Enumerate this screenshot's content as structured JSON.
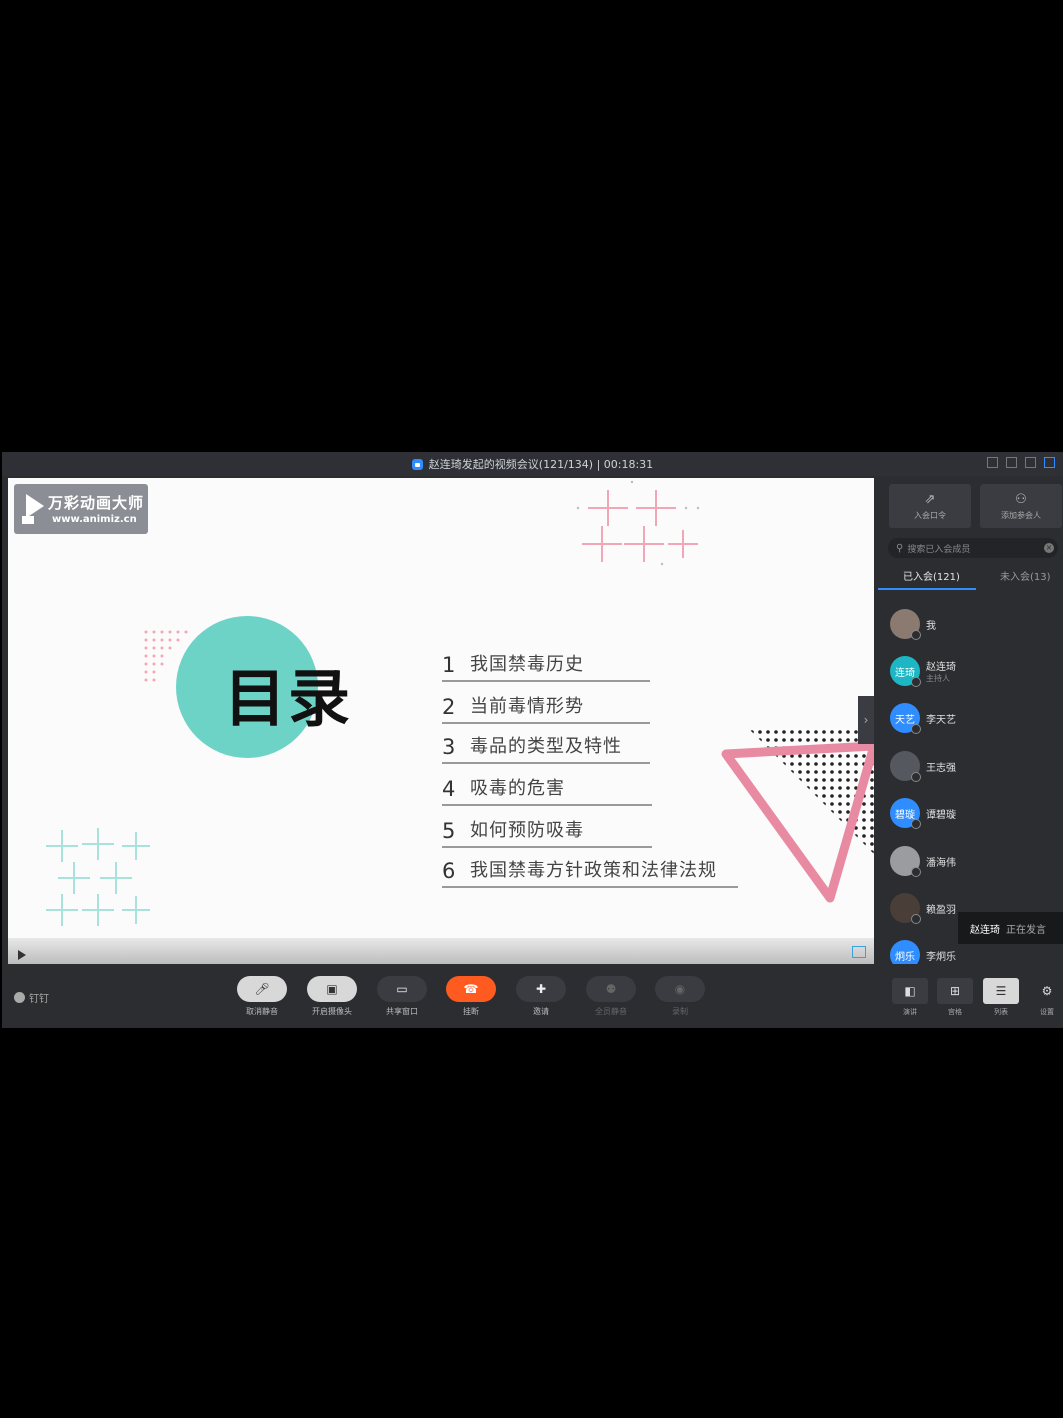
{
  "window": {
    "title": "赵连琦发起的视频会议(121/134) | 00:18:31"
  },
  "slide": {
    "logo": {
      "name": "万彩动画大师",
      "url": "www.animiz.cn"
    },
    "toc_title": "目录",
    "items": [
      {
        "num": "1",
        "label": "我国禁毒历史"
      },
      {
        "num": "2",
        "label": "当前毒情形势"
      },
      {
        "num": "3",
        "label": "毒品的类型及特性"
      },
      {
        "num": "4",
        "label": "吸毒的危害"
      },
      {
        "num": "5",
        "label": "如何预防吸毒"
      },
      {
        "num": "6",
        "label": "我国禁毒方针政策和法律法规"
      }
    ],
    "colors": {
      "circle": "#6dd3c7",
      "triangle": "#e98aa3",
      "accent_cross": "#f3a6b8",
      "teal_cross": "#a7e3dc"
    }
  },
  "panel": {
    "buttons": [
      {
        "icon": "share-icon",
        "label": "入会口令"
      },
      {
        "icon": "add-user-icon",
        "label": "添加参会人"
      }
    ],
    "search_placeholder": "搜索已入会成员",
    "tabs": [
      {
        "label": "已入会(121)",
        "active": true
      },
      {
        "label": "未入会(13)",
        "active": false
      }
    ],
    "members": [
      {
        "name": "我",
        "role": "",
        "avatar_text": ""
      },
      {
        "name": "赵连琦",
        "role": "主持人",
        "avatar_text": "连琦"
      },
      {
        "name": "李天艺",
        "role": "",
        "avatar_text": "天艺"
      },
      {
        "name": "王志强",
        "role": "",
        "avatar_text": ""
      },
      {
        "name": "谭碧璇",
        "role": "",
        "avatar_text": "碧璇"
      },
      {
        "name": "潘海伟",
        "role": "",
        "avatar_text": ""
      },
      {
        "name": "赖盈羽",
        "role": "",
        "avatar_text": ""
      },
      {
        "name": "李炯乐",
        "role": "",
        "avatar_text": "炯乐"
      }
    ],
    "speaking": {
      "name": "赵连琦",
      "status": "正在发言"
    }
  },
  "toolbar": {
    "app_label": "钉钉",
    "buttons": [
      {
        "label": "取消静音",
        "icon": "mic-icon"
      },
      {
        "label": "开启摄像头",
        "icon": "camera-icon"
      },
      {
        "label": "共享窗口",
        "icon": "share-screen-icon"
      },
      {
        "label": "挂断",
        "icon": "hangup-icon"
      },
      {
        "label": "邀请",
        "icon": "invite-icon"
      },
      {
        "label": "全员静音",
        "icon": "mute-all-icon"
      },
      {
        "label": "录制",
        "icon": "record-icon"
      }
    ],
    "views": [
      {
        "label": "演讲",
        "active": false
      },
      {
        "label": "宫格",
        "active": false
      },
      {
        "label": "列表",
        "active": true
      },
      {
        "label": "设置",
        "active": false
      }
    ]
  }
}
